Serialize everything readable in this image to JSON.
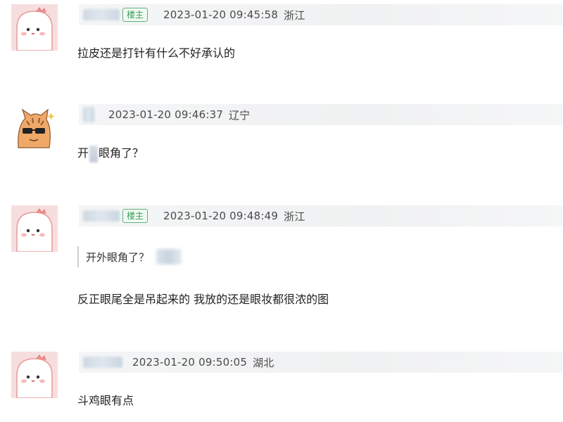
{
  "comments": [
    {
      "badge": "楼主",
      "timestamp": "2023-01-20 09:45:58",
      "location": "浙江",
      "text": "拉皮还是打针有什么不好承认的"
    },
    {
      "timestamp": "2023-01-20 09:46:37",
      "location": "辽宁",
      "text_before": "开",
      "text_after": "眼角了？"
    },
    {
      "badge": "楼主",
      "timestamp": "2023-01-20 09:48:49",
      "location": "浙江",
      "quote": "开外眼角了？",
      "text": "反正眼尾全是吊起来的 我放的还是眼妆都很浓的图"
    },
    {
      "timestamp": "2023-01-20 09:50:05",
      "location": "湖北",
      "text": "斗鸡眼有点"
    }
  ],
  "colors": {
    "badge_border": "#62b37a",
    "badge_text": "#3d9a58",
    "meta_bar": "#f2f3f4",
    "avatar_pink": "#f7dede"
  }
}
